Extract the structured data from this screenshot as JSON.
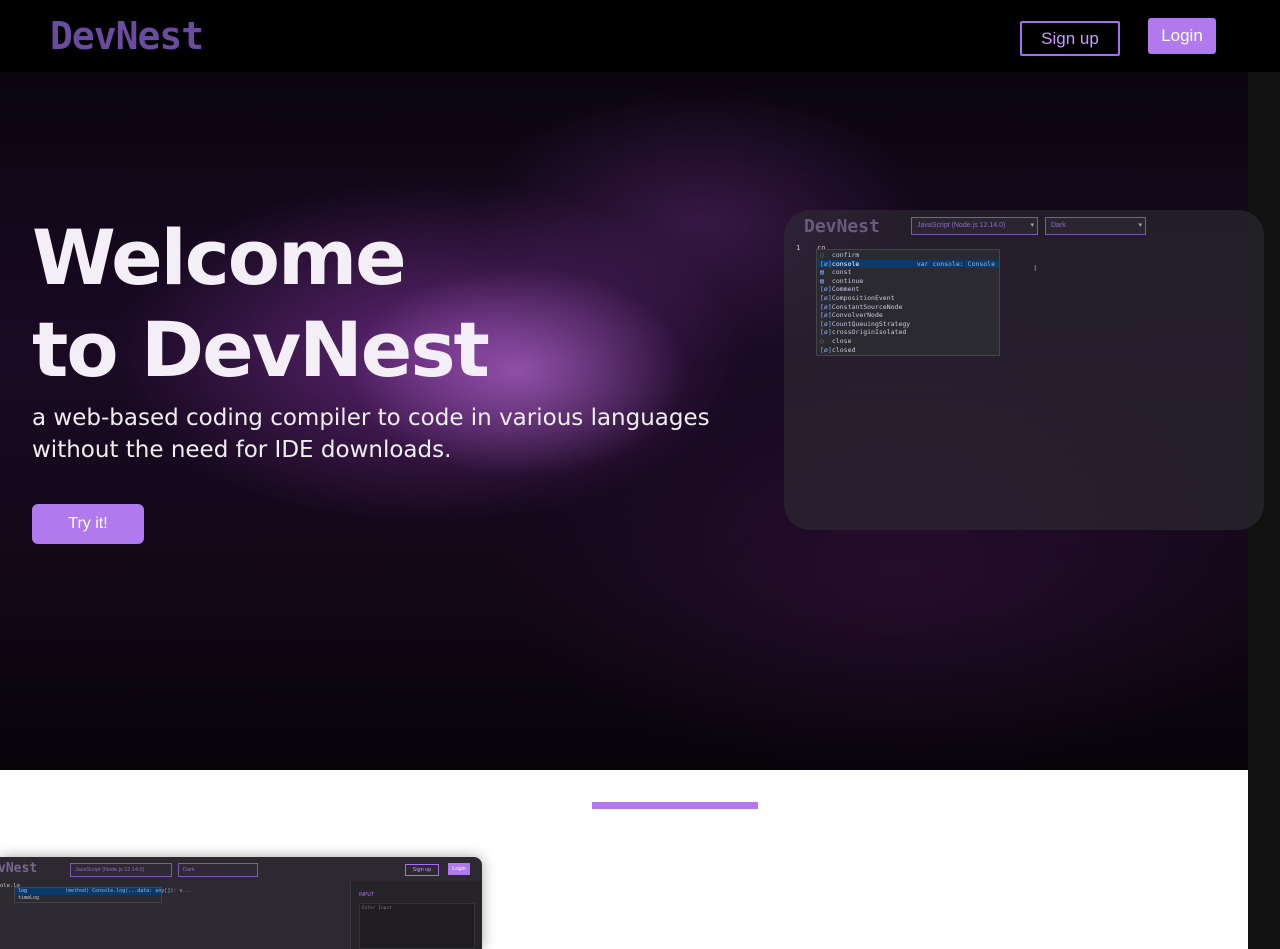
{
  "nav": {
    "logo": "DevNest",
    "signup_label": "Sign up",
    "login_label": "Login"
  },
  "hero": {
    "title_line1": "Welcome",
    "title_line2": "to DevNest",
    "subtitle_line1": "a web-based coding compiler to code in various languages",
    "subtitle_line2": "without the need for IDE downloads.",
    "cta_label": "Try it!"
  },
  "preview": {
    "logo": "DevNest",
    "language": "JavaScript (Node.js 12.14.0)",
    "theme": "Dark",
    "line_number": "1",
    "code": "co",
    "cursor": "I",
    "suggestions": [
      {
        "icon": "◌",
        "label": "confirm",
        "detail": ""
      },
      {
        "icon": "[ø]",
        "label": "console",
        "detail": "var console: Console"
      },
      {
        "icon": "▤",
        "label": "const",
        "detail": ""
      },
      {
        "icon": "▤",
        "label": "continue",
        "detail": ""
      },
      {
        "icon": "[ø]",
        "label": "Comment",
        "detail": ""
      },
      {
        "icon": "[ø]",
        "label": "CompositionEvent",
        "detail": ""
      },
      {
        "icon": "[ø]",
        "label": "ConstantSourceNode",
        "detail": ""
      },
      {
        "icon": "[ø]",
        "label": "ConvolverNode",
        "detail": ""
      },
      {
        "icon": "[ø]",
        "label": "CountQueuingStrategy",
        "detail": ""
      },
      {
        "icon": "[ø]",
        "label": "crossOriginIsolated",
        "detail": ""
      },
      {
        "icon": "◌",
        "label": "close",
        "detail": ""
      },
      {
        "icon": "[ø]",
        "label": "closed",
        "detail": ""
      }
    ]
  },
  "screenshot": {
    "logo": "vNest",
    "language": "JavaScript (Node.js 12.14.0)",
    "theme": "Dark",
    "signup_label": "Sign up",
    "login_label": "Login",
    "code": "ole.lo",
    "suggestions": [
      {
        "label": "log",
        "detail": "(method) Console.log(...data: any[]): v..."
      },
      {
        "label": "timeLog",
        "detail": ""
      }
    ],
    "input_label": "INPUT",
    "input_placeholder": "Enter Input"
  },
  "colors": {
    "accent": "#b07aee",
    "logo": "#6b4b9e",
    "nav_bg": "#000000",
    "section_bg": "#ffffff"
  }
}
